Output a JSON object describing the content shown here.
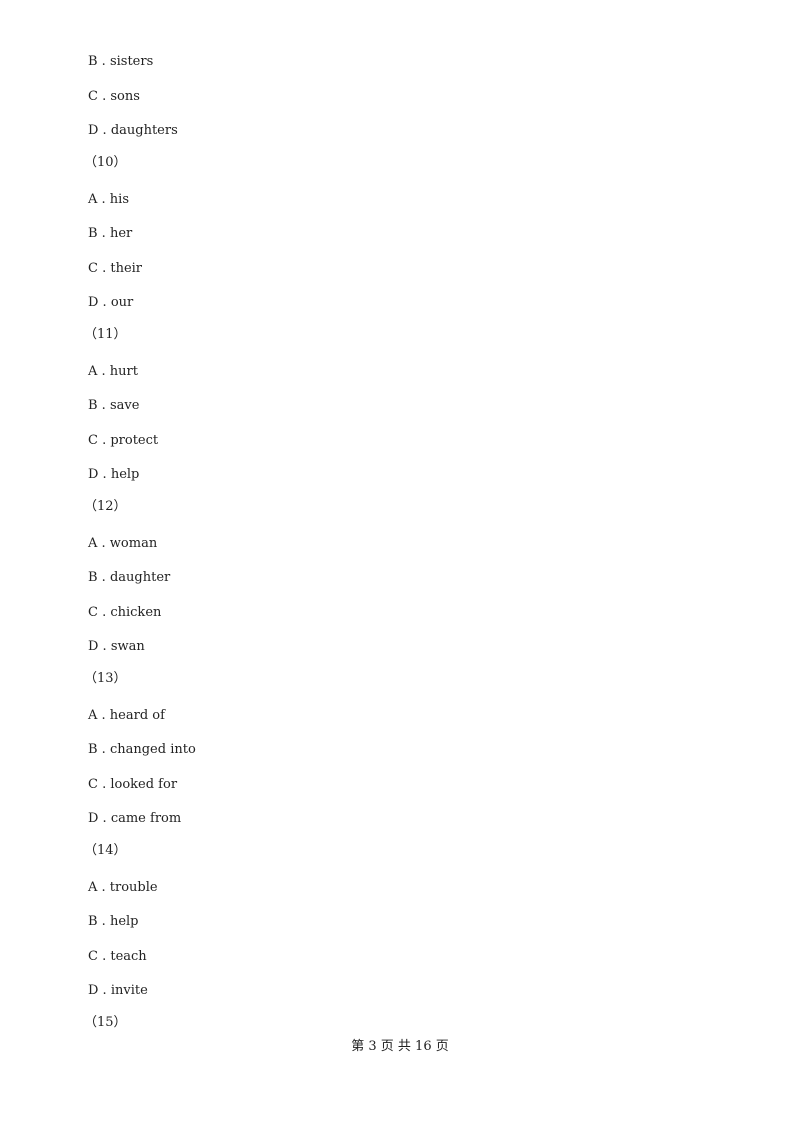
{
  "lines": [
    {
      "type": "option",
      "text": "B . sisters"
    },
    {
      "type": "option",
      "text": "C . sons"
    },
    {
      "type": "option",
      "text": "D . daughters"
    },
    {
      "type": "question",
      "text": "（10）"
    },
    {
      "type": "option",
      "text": "A . his"
    },
    {
      "type": "option",
      "text": "B . her"
    },
    {
      "type": "option",
      "text": "C . their"
    },
    {
      "type": "option",
      "text": "D . our"
    },
    {
      "type": "question",
      "text": "（11）"
    },
    {
      "type": "option",
      "text": "A . hurt"
    },
    {
      "type": "option",
      "text": "B . save"
    },
    {
      "type": "option",
      "text": "C . protect"
    },
    {
      "type": "option",
      "text": "D . help"
    },
    {
      "type": "question",
      "text": "（12）"
    },
    {
      "type": "option",
      "text": "A . woman"
    },
    {
      "type": "option",
      "text": "B . daughter"
    },
    {
      "type": "option",
      "text": "C . chicken"
    },
    {
      "type": "option",
      "text": "D . swan"
    },
    {
      "type": "question",
      "text": "（13）"
    },
    {
      "type": "option",
      "text": "A . heard of"
    },
    {
      "type": "option",
      "text": "B . changed into"
    },
    {
      "type": "option",
      "text": "C . looked for"
    },
    {
      "type": "option",
      "text": "D . came from"
    },
    {
      "type": "question",
      "text": "（14）"
    },
    {
      "type": "option",
      "text": "A . trouble"
    },
    {
      "type": "option",
      "text": "B . help"
    },
    {
      "type": "option",
      "text": "C . teach"
    },
    {
      "type": "option",
      "text": "D . invite"
    },
    {
      "type": "question",
      "text": "（15）"
    }
  ],
  "footer": "第 3 页 共 16 页"
}
